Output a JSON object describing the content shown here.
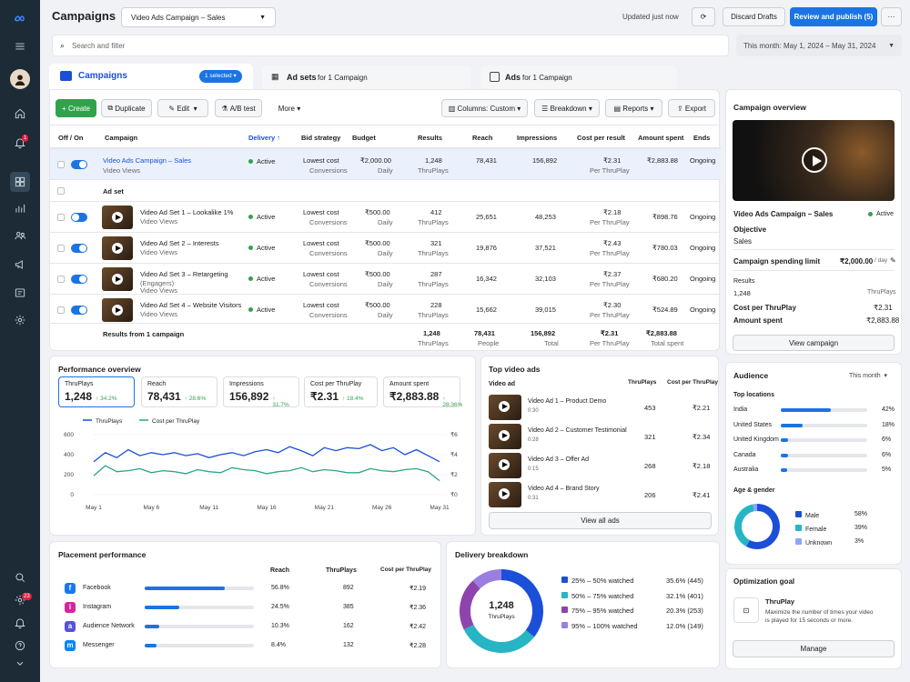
{
  "colors": {
    "brand": "#1b74e4",
    "green": "#31a24c",
    "teal": "#26b5c4",
    "purple": "#8e44ad",
    "violet": "#9b59b6",
    "rail": "#1c2b36"
  },
  "header": {
    "title": "Campaigns",
    "campaign_select": "Video Ads Campaign – Sales",
    "updated": "Updated just now",
    "discard": "Discard Drafts",
    "review": "Review and publish (5)",
    "more_icon": "ellipsis-icon"
  },
  "search": {
    "placeholder": "Search and filter",
    "date_range": "This month: May 1, 2024 – May 31, 2024"
  },
  "tabs": {
    "campaigns": "Campaigns",
    "selected": "1 selected",
    "adsets": "Ad sets",
    "adsets_sub": "for 1 Campaign",
    "ads": "Ads",
    "ads_sub": "for 1 Campaign"
  },
  "toolbar": {
    "create": "Create",
    "duplicate": "Duplicate",
    "edit": "Edit",
    "ab": "A/B test",
    "more": "More",
    "columns": "Columns: Custom",
    "breakdown": "Breakdown",
    "reports": "Reports",
    "export": "Export"
  },
  "table": {
    "headers": [
      "Off / On",
      "Campaign",
      "Delivery ↑",
      "Bid strategy",
      "Budget",
      "Results",
      "Reach",
      "Impressions",
      "Cost per result",
      "Amount spent",
      "Ends"
    ],
    "campaign": {
      "name": "Video Ads Campaign – Sales",
      "sub": "Video Views",
      "delivery": "Active",
      "bid": "Lowest cost",
      "bid_sub": "Conversions",
      "budget": "₹2,000.00",
      "budget_sub": "Daily",
      "results": "1,248",
      "results_sub": "ThruPlays",
      "reach": "78,431",
      "impressions": "156,892",
      "cpr": "₹2.31",
      "cpr_sub": "Per ThruPlay",
      "spent": "₹2,883.88",
      "ends": "Ongoing"
    },
    "adset_label": "Ad set",
    "adsets": [
      {
        "name": "Video Ad Set 1 – Lookalike 1%",
        "sub": "Video Views",
        "sub2": "",
        "delivery": "Active",
        "bid": "Lowest cost",
        "bid_sub": "Conversions",
        "budget": "₹500.00",
        "budget_sub": "Daily",
        "results": "412",
        "results_sub": "ThruPlays",
        "reach": "25,651",
        "impressions": "48,253",
        "cpr": "₹2.18",
        "cpr_sub": "Per ThruPlay",
        "spent": "₹898.76",
        "ends": "Ongoing"
      },
      {
        "name": "Video Ad Set 2 – Interests",
        "sub": "Video Views",
        "sub2": "",
        "delivery": "Active",
        "bid": "Lowest cost",
        "bid_sub": "Conversions",
        "budget": "₹500.00",
        "budget_sub": "Daily",
        "results": "321",
        "results_sub": "ThruPlays",
        "reach": "19,876",
        "impressions": "37,521",
        "cpr": "₹2.43",
        "cpr_sub": "Per ThruPlay",
        "spent": "₹780.03",
        "ends": "Ongoing"
      },
      {
        "name": "Video Ad Set 3 – Retargeting",
        "sub": "(Engagers)",
        "sub2": "Video Views",
        "delivery": "Active",
        "bid": "Lowest cost",
        "bid_sub": "Conversions",
        "budget": "₹500.00",
        "budget_sub": "Daily",
        "results": "287",
        "results_sub": "ThruPlays",
        "reach": "16,342",
        "impressions": "32,103",
        "cpr": "₹2.37",
        "cpr_sub": "Per ThruPlay",
        "spent": "₹680.20",
        "ends": "Ongoing"
      },
      {
        "name": "Video Ad Set 4 – Website Visitors",
        "sub": "Video Views",
        "sub2": "",
        "delivery": "Active",
        "bid": "Lowest cost",
        "bid_sub": "Conversions",
        "budget": "₹500.00",
        "budget_sub": "Daily",
        "results": "228",
        "results_sub": "ThruPlays",
        "reach": "15,662",
        "impressions": "39,015",
        "cpr": "₹2.30",
        "cpr_sub": "Per ThruPlay",
        "spent": "₹524.89",
        "ends": "Ongoing"
      }
    ],
    "totals": {
      "label": "Results from 1 campaign",
      "results": "1,248",
      "results_sub": "ThruPlays",
      "reach": "78,431",
      "reach_sub": "People",
      "impressions": "156,892",
      "impressions_sub": "Total",
      "cpr": "₹2.31",
      "cpr_sub": "Per ThruPlay",
      "spent": "₹2,883.88",
      "spent_sub": "Total spent"
    }
  },
  "overview": {
    "title": "Campaign overview",
    "name": "Video Ads Campaign – Sales",
    "status": "Active",
    "objective_label": "Objective",
    "objective": "Sales",
    "limit_label": "Campaign spending limit",
    "limit": "₹2,000.00",
    "limit_unit": "/ day",
    "results_label": "Results",
    "results": "1,248",
    "results_unit": "ThruPlays",
    "cpt_label": "Cost per ThruPlay",
    "cpt": "₹2.31",
    "spent_label": "Amount spent",
    "spent": "₹2,883.88",
    "view": "View campaign"
  },
  "performance": {
    "title": "Performance overview",
    "kpis": [
      {
        "label": "ThruPlays",
        "value": "1,248",
        "delta": "↑ 34.2%"
      },
      {
        "label": "Reach",
        "value": "78,431",
        "delta": "↑ 28.6%"
      },
      {
        "label": "Impressions",
        "value": "156,892",
        "delta": "↑ 31.7%"
      },
      {
        "label": "Cost per ThruPlay",
        "value": "₹2.31",
        "delta": "↑ 18.4%"
      },
      {
        "label": "Amount spent",
        "value": "₹2,883.88",
        "delta": "↑ 28.36%"
      }
    ]
  },
  "chart_data": {
    "type": "line",
    "x": [
      "May 1",
      "",
      "",
      "",
      "",
      "May 6",
      "",
      "",
      "",
      "",
      "May 11",
      "",
      "",
      "",
      "",
      "May 16",
      "",
      "",
      "",
      "",
      "May 21",
      "",
      "",
      "",
      "",
      "May 26",
      "",
      "",
      "",
      "",
      "May 31"
    ],
    "xticks": [
      "May 1",
      "May 6",
      "May 11",
      "May 16",
      "May 21",
      "May 26",
      "May 31"
    ],
    "yticks_left": [
      "0",
      "200",
      "400",
      "600"
    ],
    "yticks_right": [
      "₹0",
      "₹2",
      "₹4",
      "₹6"
    ],
    "ylim": [
      0,
      600
    ],
    "ylim_right": [
      0,
      6
    ],
    "series": [
      {
        "name": "ThruPlays",
        "axis": "left",
        "color": "#1b4fd8",
        "values": [
          330,
          420,
          370,
          450,
          390,
          420,
          400,
          420,
          390,
          410,
          370,
          400,
          420,
          390,
          430,
          450,
          420,
          480,
          440,
          390,
          470,
          440,
          470,
          460,
          500,
          440,
          470,
          400,
          450,
          390,
          330
        ]
      },
      {
        "name": "Cost per ThruPlay",
        "axis": "right",
        "color": "#2aa58a",
        "values": [
          1.9,
          2.9,
          2.3,
          2.4,
          2.6,
          2.2,
          2.4,
          2.3,
          2.1,
          2.5,
          2.3,
          2.2,
          2.7,
          2.5,
          2.4,
          2.1,
          2.3,
          2.4,
          2.7,
          2.3,
          2.5,
          2.4,
          2.2,
          2.2,
          2.6,
          2.4,
          2.3,
          2.5,
          2.6,
          2.3,
          1.4
        ]
      }
    ]
  },
  "topvideos": {
    "title": "Top video ads",
    "col_ad": "Video ad",
    "col_thru": "ThruPlays",
    "col_cost": "Cost per ThruPlay",
    "items": [
      {
        "name": "Video Ad 1 – Product Demo",
        "dur": "0:30",
        "thru": "453",
        "cost": "₹2.21"
      },
      {
        "name": "Video Ad 2 – Customer Testimonial",
        "dur": "0:28",
        "thru": "321",
        "cost": "₹2.34"
      },
      {
        "name": "Video Ad 3 – Offer Ad",
        "dur": "0:15",
        "thru": "268",
        "cost": "₹2.18"
      },
      {
        "name": "Video Ad 4 – Brand Story",
        "dur": "0:31",
        "thru": "206",
        "cost": "₹2.41"
      }
    ],
    "view_all": "View all ads"
  },
  "audience": {
    "title": "Audience",
    "range": "This month",
    "locations_label": "Top locations",
    "locations": [
      {
        "name": "India",
        "pct": "42%",
        "value": 0.42
      },
      {
        "name": "United States",
        "pct": "18%",
        "value": 0.18
      },
      {
        "name": "United Kingdom",
        "pct": "6%",
        "value": 0.06
      },
      {
        "name": "Canada",
        "pct": "6%",
        "value": 0.06
      },
      {
        "name": "Australia",
        "pct": "5%",
        "value": 0.05
      }
    ],
    "gender_label": "Age & gender",
    "gender": [
      {
        "name": "Male",
        "pct": "58%",
        "value": 58,
        "color": "#1b4fd8"
      },
      {
        "name": "Female",
        "pct": "39%",
        "value": 39,
        "color": "#26b5c4"
      },
      {
        "name": "Unknown",
        "pct": "3%",
        "value": 3,
        "color": "#8ea4ff"
      }
    ]
  },
  "placement": {
    "title": "Placement performance",
    "cols": [
      "Reach",
      "ThruPlays",
      "Cost per ThruPlay"
    ],
    "rows": [
      {
        "name": "Facebook",
        "reach": "56.8%",
        "thru": "892",
        "cost": "₹2.19",
        "value": 0.568,
        "icon": "facebook-icon",
        "color": "#1877f2"
      },
      {
        "name": "Instagram",
        "reach": "24.5%",
        "thru": "385",
        "cost": "₹2.36",
        "value": 0.245,
        "icon": "instagram-icon",
        "color": "#d6249f"
      },
      {
        "name": "Audience Network",
        "reach": "10.3%",
        "thru": "162",
        "cost": "₹2.42",
        "value": 0.103,
        "icon": "audience-network-icon",
        "color": "#5851db"
      },
      {
        "name": "Messenger",
        "reach": "8.4%",
        "thru": "132",
        "cost": "₹2.28",
        "value": 0.084,
        "icon": "messenger-icon",
        "color": "#0084ff"
      }
    ]
  },
  "delivery": {
    "title": "Delivery breakdown",
    "center_value": "1,248",
    "center_label": "ThruPlays",
    "items": [
      {
        "label": "25% – 50% watched",
        "value": "35.6% (445)",
        "pct": 35.6,
        "color": "#1b4fd8"
      },
      {
        "label": "50% – 75% watched",
        "value": "32.1% (401)",
        "pct": 32.1,
        "color": "#26b5c4"
      },
      {
        "label": "75% – 95% watched",
        "value": "20.3% (253)",
        "pct": 20.3,
        "color": "#8e44ad"
      },
      {
        "label": "95% – 100% watched",
        "value": "12.0% (149)",
        "pct": 12.0,
        "color": "#9b7fe0"
      }
    ]
  },
  "optimization": {
    "title": "Optimization goal",
    "goal": "ThruPlay",
    "desc1": "Maximize the number of times your video",
    "desc2": "is played for 15 seconds or more.",
    "manage": "Manage"
  },
  "rail": {
    "badge1": "1",
    "badge2": "23"
  }
}
